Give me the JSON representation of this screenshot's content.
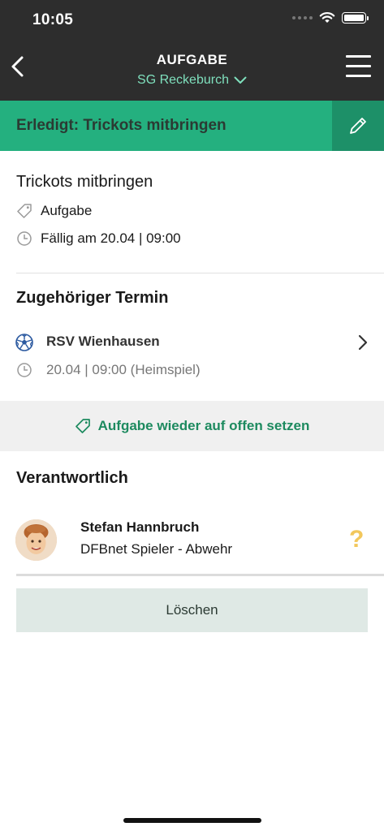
{
  "status": {
    "time": "10:05"
  },
  "nav": {
    "title": "AUFGABE",
    "subtitle": "SG Reckeburch"
  },
  "banner": {
    "label": "Erledigt: Trickots mitbringen"
  },
  "task": {
    "title": "Trickots mitbringen",
    "type": "Aufgabe",
    "due": "Fällig am 20.04 | 09:00"
  },
  "event": {
    "section_title": "Zugehöriger Termin",
    "name": "RSV Wienhausen",
    "time": "20.04 | 09:00 (Heimspiel)"
  },
  "reopen": {
    "label": "Aufgabe wieder auf offen setzen"
  },
  "responsible": {
    "section_title": "Verantwortlich",
    "name": "Stefan Hannbruch",
    "role": "DFBnet Spieler - Abwehr",
    "status_glyph": "?"
  },
  "actions": {
    "delete_label": "Löschen"
  },
  "colors": {
    "header_bg": "#2d2d2d",
    "accent_green": "#24b07f",
    "accent_green_dark": "#1d9068",
    "link_green": "#1d8a5f",
    "subtitle_mint": "#7fe0bd",
    "question_yellow": "#f2c75c",
    "delete_bg": "#dfe9e5"
  },
  "icons": [
    "back-arrow-icon",
    "chevron-down-icon",
    "hamburger-menu-icon",
    "pencil-icon",
    "tag-icon",
    "clock-icon",
    "soccer-ball-icon",
    "chevron-right-icon",
    "wifi-icon",
    "battery-icon"
  ]
}
